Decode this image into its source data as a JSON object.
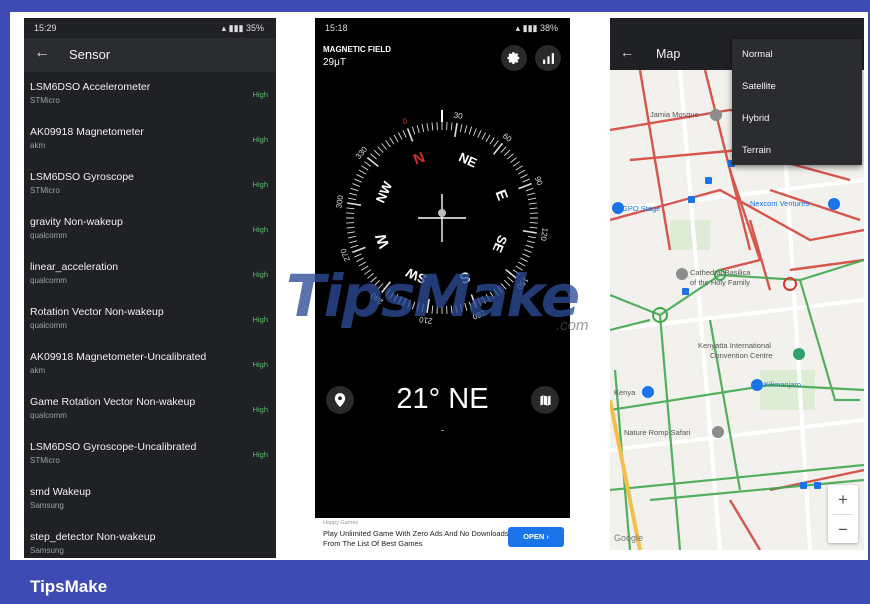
{
  "brand": "TipsMake",
  "watermark": {
    "text": "TipsMake",
    "suffix": ".com"
  },
  "phone1": {
    "status_time": "15:29",
    "status_right": "35%",
    "title": "Sensor",
    "sensors": [
      {
        "name": "LSM6DSO Accelerometer",
        "vendor": "STMicro",
        "accuracy": "High"
      },
      {
        "name": "AK09918 Magnetometer",
        "vendor": "akm",
        "accuracy": "High"
      },
      {
        "name": "LSM6DSO Gyroscope",
        "vendor": "STMicro",
        "accuracy": "High"
      },
      {
        "name": "gravity  Non-wakeup",
        "vendor": "qualcomm",
        "accuracy": "High"
      },
      {
        "name": "linear_acceleration",
        "vendor": "qualcomm",
        "accuracy": "High"
      },
      {
        "name": "Rotation Vector  Non-wakeup",
        "vendor": "qualcomm",
        "accuracy": "High"
      },
      {
        "name": "AK09918 Magnetometer-Uncalibrated",
        "vendor": "akm",
        "accuracy": "High"
      },
      {
        "name": "Game Rotation Vector  Non-wakeup",
        "vendor": "qualcomm",
        "accuracy": "High"
      },
      {
        "name": "LSM6DSO Gyroscope-Uncalibrated",
        "vendor": "STMicro",
        "accuracy": "High"
      },
      {
        "name": "smd  Wakeup",
        "vendor": "Samsung",
        "accuracy": ""
      },
      {
        "name": "step_detector  Non-wakeup",
        "vendor": "Samsung",
        "accuracy": ""
      }
    ]
  },
  "phone2": {
    "status_time": "15:18",
    "status_right": "38%",
    "magnetic_label": "MAGNETIC FIELD",
    "magnetic_value": "29μT",
    "heading": "21° NE",
    "compass": {
      "rotation_deg": -21,
      "degree_labels": [
        "0",
        "30",
        "60",
        "90",
        "120",
        "150",
        "180",
        "210",
        "240",
        "270",
        "300",
        "330"
      ],
      "directions": [
        "N",
        "NE",
        "E",
        "SE",
        "S",
        "SW",
        "W",
        "NW"
      ]
    },
    "ad": {
      "source": "Happy Games",
      "text": "Play Unlimited Game With Zero Ads And No Downloads From The List Of Best Games",
      "button": "OPEN"
    }
  },
  "phone3": {
    "title": "Map",
    "menu": [
      "Normal",
      "Satellite",
      "Hybrid",
      "Terrain"
    ],
    "labels": {
      "jamia": "Jamia Mosque",
      "gpo": "GPO Stage",
      "nexcom": "Nexcom Ventures",
      "cathedral1": "Cathedral Basilica",
      "cathedral2": "of the Holy Family",
      "kicc1": "Kenyatta International",
      "kicc2": "Convention Centre",
      "kilimanjaro": "Kilimanjaro",
      "kenya": "Kenya",
      "nature": "Nature Romp Safari",
      "google": "Google"
    },
    "zoom_in": "+",
    "zoom_out": "−"
  }
}
